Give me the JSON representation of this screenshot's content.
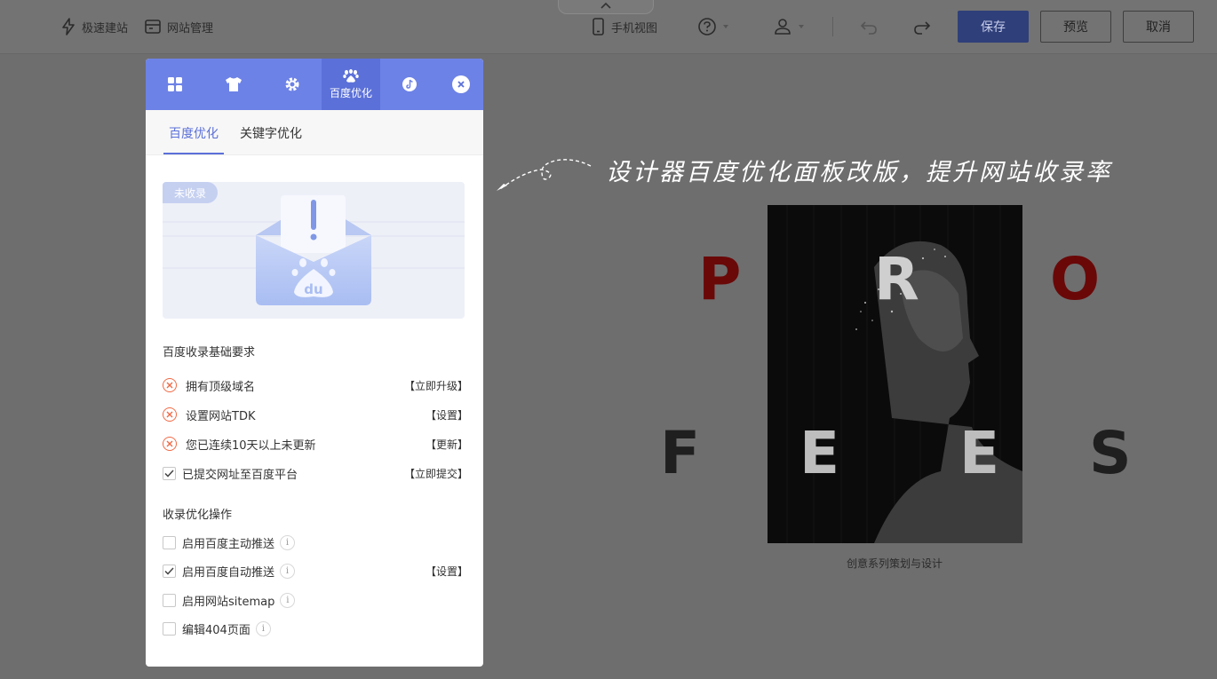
{
  "toolbar": {
    "quick_build": "极速建站",
    "site_manage": "网站管理",
    "mobile_view": "手机视图",
    "save": "保存",
    "preview": "预览",
    "cancel": "取消"
  },
  "panel": {
    "tabs": [
      {
        "icon": "grid-icon"
      },
      {
        "icon": "tshirt-icon"
      },
      {
        "icon": "gear-icon"
      },
      {
        "icon": "paw-icon",
        "label": "百度优化",
        "active": true
      },
      {
        "icon": "tiktok-icon"
      }
    ],
    "subtabs": [
      "百度优化",
      "关键字优化"
    ],
    "banner_badge": "未收录",
    "requirements_title": "百度收录基础要求",
    "requirements": [
      {
        "label": "拥有顶级域名",
        "action": "【立即升级】",
        "status": "fail"
      },
      {
        "label": "设置网站TDK",
        "action": "【设置】",
        "status": "fail"
      },
      {
        "label": "您已连续10天以上未更新",
        "action": "【更新】",
        "status": "fail"
      },
      {
        "label": "已提交网址至百度平台",
        "action": "【立即提交】",
        "status": "ok"
      }
    ],
    "operations_title": "收录优化操作",
    "operations": [
      {
        "label": "启用百度主动推送",
        "checked": false,
        "action": ""
      },
      {
        "label": "启用百度自动推送",
        "checked": true,
        "action": "【设置】"
      },
      {
        "label": "启用网站sitemap",
        "checked": false,
        "action": ""
      },
      {
        "label": "编辑404页面",
        "checked": false,
        "action": ""
      }
    ]
  },
  "canvas": {
    "annotation": "设计器百度优化面板改版，提升网站收录率",
    "letters": [
      "P",
      "R",
      "O",
      "F",
      "E",
      "E",
      "S"
    ],
    "caption": "创意系列策划与设计"
  },
  "colors": {
    "accent": "#6d82e6",
    "accent_dark": "#5b70d8",
    "error": "#f06a45",
    "letter_red": "#7a0a0a"
  }
}
